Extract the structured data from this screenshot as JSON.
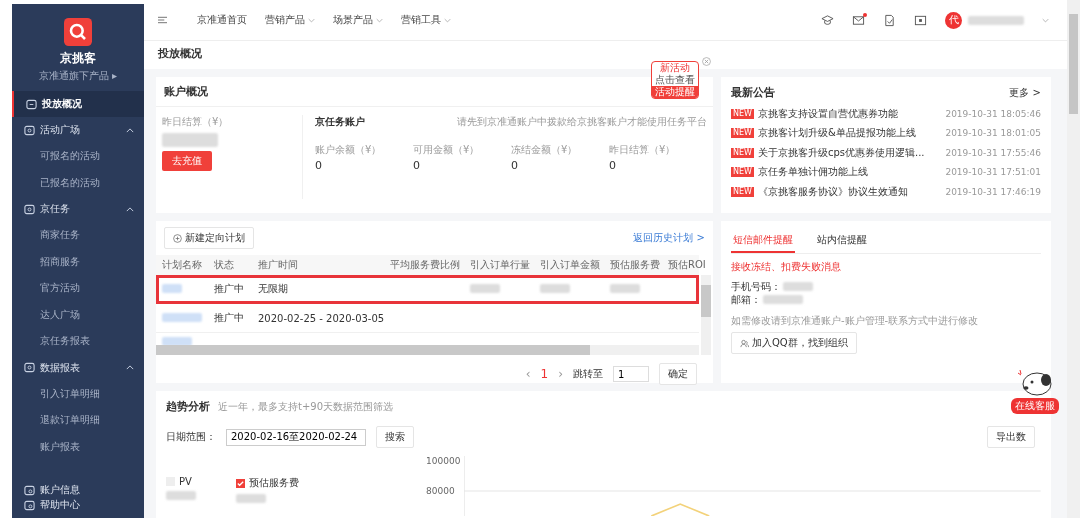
{
  "sidebar": {
    "brand": "京挑客",
    "subtitle": "京准通旗下产品 ▸",
    "items": [
      {
        "label": "投放概况",
        "kind": "page",
        "selected": true
      },
      {
        "label": "活动广场",
        "kind": "group",
        "selected": false,
        "expanded": true,
        "children": [
          {
            "label": "可报名的活动",
            "selected": false
          },
          {
            "label": "已报名的活动",
            "selected": false
          }
        ]
      },
      {
        "label": "京任务",
        "kind": "group",
        "selected": false,
        "expanded": true,
        "children": [
          {
            "label": "商家任务",
            "selected": false
          },
          {
            "label": "招商服务",
            "selected": false
          },
          {
            "label": "官方活动",
            "selected": false
          },
          {
            "label": "达人广场",
            "selected": false
          },
          {
            "label": "京任务报表",
            "selected": false
          }
        ]
      },
      {
        "label": "数据报表",
        "kind": "group",
        "selected": false,
        "expanded": true,
        "children": [
          {
            "label": "引入订单明细",
            "selected": false
          },
          {
            "label": "退款订单明细",
            "selected": false
          },
          {
            "label": "账户报表",
            "selected": false
          }
        ]
      }
    ],
    "footer": [
      "账户信息",
      "帮助中心"
    ]
  },
  "topbar": {
    "menu": [
      {
        "label": "京准通首页",
        "dropdown": false
      },
      {
        "label": "营销产品",
        "dropdown": true
      },
      {
        "label": "场景产品",
        "dropdown": true
      },
      {
        "label": "营销工具",
        "dropdown": true
      }
    ],
    "mail_unread": true,
    "avatar": "代"
  },
  "page_title": "投放概况",
  "account": {
    "title": "账户概况",
    "settle_label": "昨日结算（¥）",
    "recharge": "去充值",
    "task_title": "京任务账户",
    "task_note": "请先到京准通账户中拨款给京挑客账户才能使用任务平台",
    "stats": [
      {
        "label": "账户余额（¥）",
        "value": "0"
      },
      {
        "label": "可用金额（¥）",
        "value": "0"
      },
      {
        "label": "冻结金额（¥）",
        "value": "0"
      },
      {
        "label": "昨日结算（¥）",
        "value": "0"
      }
    ]
  },
  "promo_badge": [
    "新活动",
    "点击查看",
    "活动提醒"
  ],
  "notices": {
    "title": "最新公告",
    "more": "更多 >",
    "items": [
      {
        "tag": "NEW",
        "text": "京挑客支持设置自营优惠券功能",
        "date": "2019-10-31 18:05:46"
      },
      {
        "tag": "NEW",
        "text": "京挑客计划升级&单品提报功能上线",
        "date": "2019-10-31 18:01:05"
      },
      {
        "tag": "NEW",
        "text": "关于京挑客升级cps优惠券使用逻辑...",
        "date": "2019-10-31 17:55:46"
      },
      {
        "tag": "NEW",
        "text": "京任务单独计佣功能上线",
        "date": "2019-10-31 17:51:01"
      },
      {
        "tag": "NEW",
        "text": "《京挑客服务协议》协议生效通知",
        "date": "2019-10-31 17:46:19"
      }
    ]
  },
  "plans": {
    "new_button": "新建定向计划",
    "history_link": "返回历史计划 >",
    "columns": [
      "计划名称",
      "状态",
      "推广时间",
      "平均服务费比例",
      "引入订单行量",
      "引入订单金额",
      "预估服务费",
      "预估ROI"
    ],
    "rows": [
      {
        "status": "推广中",
        "period": "无限期",
        "highlighted": true
      },
      {
        "status": "推广中",
        "period": "2020-02-25 - 2020-03-05",
        "highlighted": false
      }
    ],
    "pager": {
      "prev": "‹",
      "page": "1",
      "next": "›",
      "jump_label": "跳转至",
      "jump_value": "1",
      "confirm": "确定"
    }
  },
  "alerts": {
    "tabs": [
      {
        "label": "短信邮件提醒",
        "selected": true
      },
      {
        "label": "站内信提醒",
        "selected": false
      }
    ],
    "warning": "接收冻结、扣费失败消息",
    "phone_label": "手机号码：",
    "email_label": "邮箱：",
    "note": "如需修改请到京准通账户-账户管理-联系方式中进行修改",
    "qq_button": "加入QQ群，找到组织"
  },
  "trend": {
    "title": "趋势分析",
    "subtitle": "近一年，最多支持t+90天数据范围筛选",
    "date_label": "日期范围：",
    "date_value": "2020-02-16至2020-02-24",
    "search": "搜索",
    "export": "导出数",
    "legend": [
      {
        "label": "PV",
        "checked": false
      },
      {
        "label": "预估服务费",
        "checked": true
      }
    ],
    "yticks": [
      "100000",
      "80000"
    ]
  },
  "service_label": "在线客服"
}
